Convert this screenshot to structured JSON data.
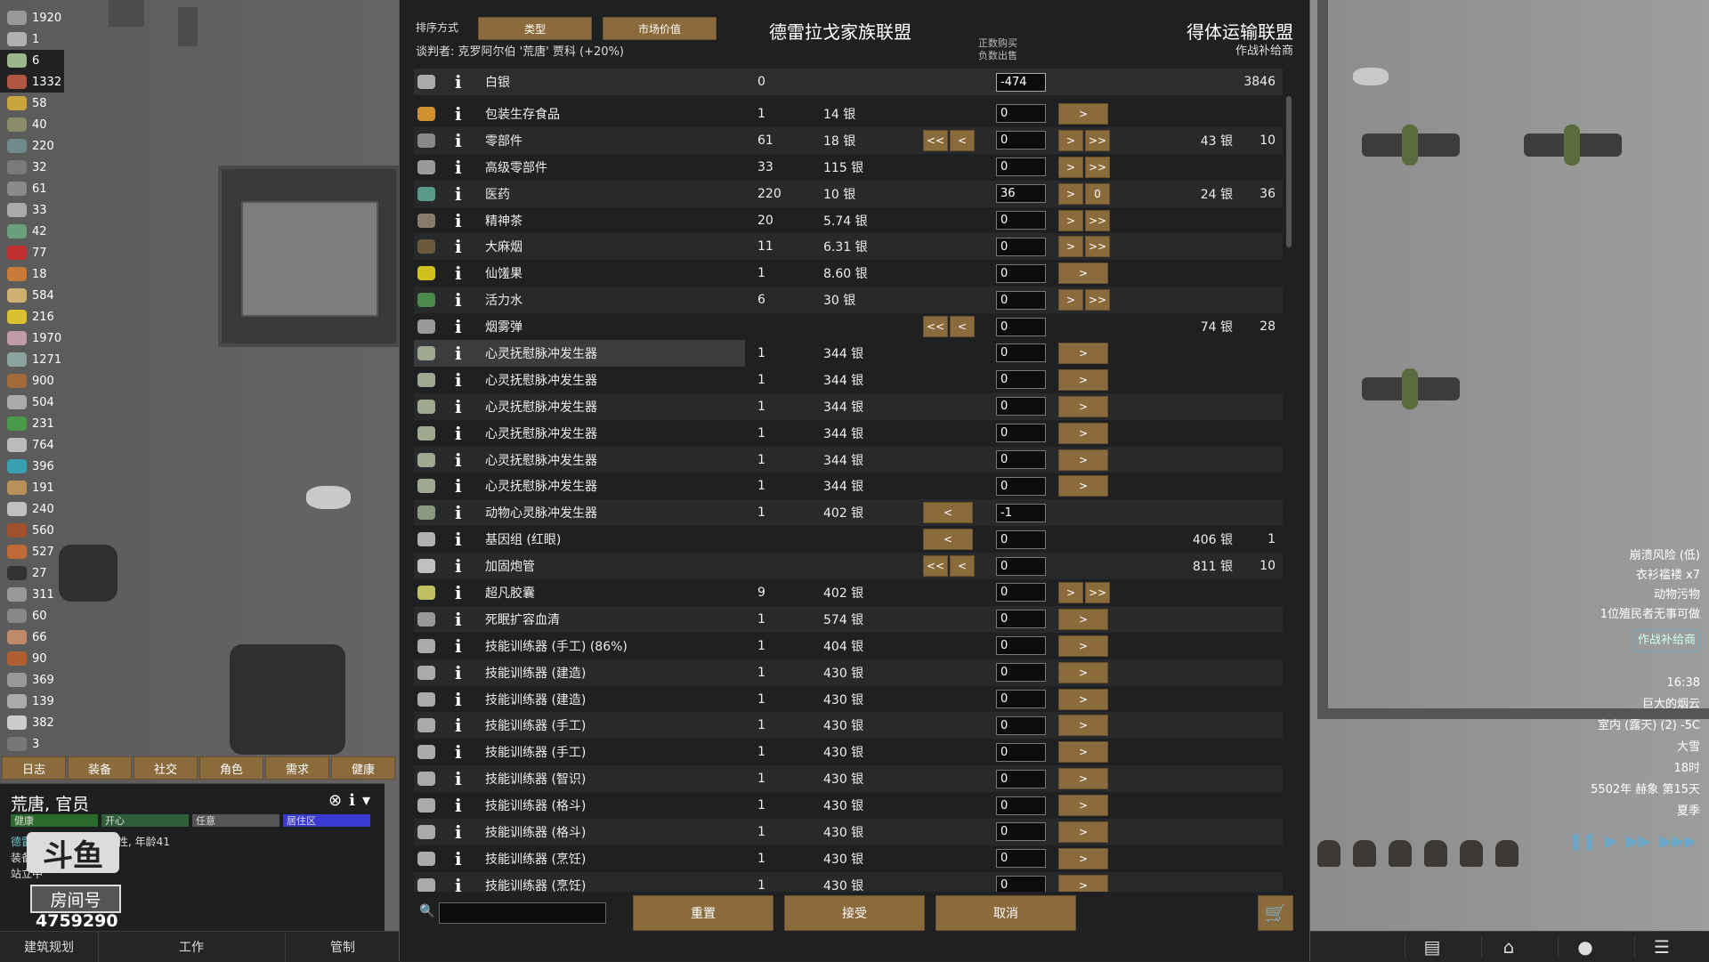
{
  "resources": [
    {
      "value": "1920",
      "color": "#9a9a9a"
    },
    {
      "value": "1",
      "color": "#b0b0b0"
    },
    {
      "value": "6",
      "color": "#9bb68a"
    },
    {
      "value": "1332",
      "color": "#b05540"
    },
    {
      "value": "58",
      "color": "#c9a53c"
    },
    {
      "value": "40",
      "color": "#8c8c6a"
    },
    {
      "value": "220",
      "color": "#6f8a8a"
    },
    {
      "value": "32",
      "color": "#7a7a7a"
    },
    {
      "value": "61",
      "color": "#8a8a8a"
    },
    {
      "value": "33",
      "color": "#aaaaaa"
    },
    {
      "value": "42",
      "color": "#6b9e7a"
    },
    {
      "value": "77",
      "color": "#c03030"
    },
    {
      "value": "18",
      "color": "#c87a3a"
    },
    {
      "value": "584",
      "color": "#d0b070"
    },
    {
      "value": "216",
      "color": "#d8c030"
    },
    {
      "value": "1970",
      "color": "#c09aa8"
    },
    {
      "value": "1271",
      "color": "#8aa2a0"
    },
    {
      "value": "900",
      "color": "#a06a3a"
    },
    {
      "value": "504",
      "color": "#aaaaaa"
    },
    {
      "value": "231",
      "color": "#4a9a4a"
    },
    {
      "value": "764",
      "color": "#bbbbbb"
    },
    {
      "value": "396",
      "color": "#3aa0b0"
    },
    {
      "value": "191",
      "color": "#b8905a"
    },
    {
      "value": "240",
      "color": "#c0c0c0"
    },
    {
      "value": "560",
      "color": "#a0522d"
    },
    {
      "value": "527",
      "color": "#c06a3a"
    },
    {
      "value": "27",
      "color": "#333333"
    },
    {
      "value": "311",
      "color": "#999999"
    },
    {
      "value": "60",
      "color": "#888888"
    },
    {
      "value": "66",
      "color": "#c08a6a"
    },
    {
      "value": "90",
      "color": "#b06030"
    },
    {
      "value": "369",
      "color": "#999999"
    },
    {
      "value": "139",
      "color": "#aaaaaa"
    },
    {
      "value": "382",
      "color": "#cccccc"
    },
    {
      "value": "3",
      "color": "#777777"
    }
  ],
  "pawn_tabs": [
    "日志",
    "装备",
    "社交",
    "角色",
    "需求",
    "健康"
  ],
  "pawn": {
    "name": "荒唐, 官员",
    "bars": [
      {
        "label": "健康",
        "color": "#2a6a2a"
      },
      {
        "label": "开心",
        "color": "#2e5e3a"
      },
      {
        "label": "任意",
        "color": "#555555"
      },
      {
        "label": "居住区",
        "color": "#3a3ad0"
      }
    ],
    "faction_link": "德雷拉戈家族联盟",
    "desc_suffix": "的男性, 年龄41",
    "equipment": "装备: 破晓雨伞",
    "status": "站立中",
    "logo": "斗鱼",
    "room_label": "房间号",
    "room_number": "4759290"
  },
  "bottom_tabs": [
    "建筑规划",
    "工作",
    "管制"
  ],
  "bottom_icons": [
    "book-icon",
    "bank-icon",
    "lightbulb-icon",
    "list-icon"
  ],
  "alerts": {
    "lines": [
      "崩溃风险 (低)",
      "衣衫褴褛 x7",
      "动物污物",
      "1位殖民者无事可做"
    ],
    "boxed": "作战补给商"
  },
  "time_info": [
    "16:38",
    "巨大的烟云",
    "室内 (露天) (2) -5C",
    "大雪",
    "18时",
    "5502年 赫象 第15天",
    "夏季"
  ],
  "trade": {
    "sort_label": "排序方式",
    "sort_buttons": [
      "类型",
      "市场价值"
    ],
    "negotiator": "谈判者: 克罗阿尔伯 '荒唐' 贾科 (+20%)",
    "faction_left": "德雷拉戈家族联盟",
    "pos_note_1": "正数购买",
    "pos_note_2": "负数出售",
    "faction_right": "得体运输联盟",
    "faction_right_sub": "作战补给商",
    "silver": {
      "name": "白银",
      "colony_qty": "0",
      "offer": "-474",
      "trader_qty": "3846",
      "icon_color": "#aaaaaa"
    },
    "rows": [
      {
        "name": "包装生存食品",
        "cq": "1",
        "price": "14 银",
        "l": "",
        "offer": "0",
        "r": ">",
        "tp": "",
        "tq": "",
        "color": "#d09030"
      },
      {
        "name": "零部件",
        "cq": "61",
        "price": "18 银",
        "l": "<< <",
        "offer": "0",
        "r": "> >>",
        "tp": "43 银",
        "tq": "10",
        "color": "#888888"
      },
      {
        "name": "高级零部件",
        "cq": "33",
        "price": "115 银",
        "l": "",
        "offer": "0",
        "r": "> >>",
        "tp": "",
        "tq": "",
        "color": "#999999"
      },
      {
        "name": "医药",
        "cq": "220",
        "price": "10 银",
        "l": "",
        "offer": "36",
        "r": "> 0",
        "tp": "24 银",
        "tq": "36",
        "color": "#5a9a8a"
      },
      {
        "name": "精神茶",
        "cq": "20",
        "price": "5.74 银",
        "l": "",
        "offer": "0",
        "r": "> >>",
        "tp": "",
        "tq": "",
        "color": "#8a7a6a"
      },
      {
        "name": "大麻烟",
        "cq": "11",
        "price": "6.31 银",
        "l": "",
        "offer": "0",
        "r": "> >>",
        "tp": "",
        "tq": "",
        "color": "#6a5a3a"
      },
      {
        "name": "仙馐果",
        "cq": "1",
        "price": "8.60 银",
        "l": "",
        "offer": "0",
        "r": ">",
        "tp": "",
        "tq": "",
        "color": "#d0c020"
      },
      {
        "name": "活力水",
        "cq": "6",
        "price": "30 银",
        "l": "",
        "offer": "0",
        "r": "> >>",
        "tp": "",
        "tq": "",
        "color": "#4a8a4a"
      },
      {
        "name": "烟雾弹",
        "cq": "",
        "price": "",
        "l": "<< <",
        "offer": "0",
        "r": "",
        "tp": "74 银",
        "tq": "28",
        "color": "#9a9a9a"
      },
      {
        "name": "心灵抚慰脉冲发生器",
        "cq": "1",
        "price": "344 银",
        "l": "",
        "offer": "0",
        "r": ">",
        "tp": "",
        "tq": "",
        "color": "#a0a890"
      },
      {
        "name": "心灵抚慰脉冲发生器",
        "cq": "1",
        "price": "344 银",
        "l": "",
        "offer": "0",
        "r": ">",
        "tp": "",
        "tq": "",
        "color": "#a0a890"
      },
      {
        "name": "心灵抚慰脉冲发生器",
        "cq": "1",
        "price": "344 银",
        "l": "",
        "offer": "0",
        "r": ">",
        "tp": "",
        "tq": "",
        "color": "#a0a890"
      },
      {
        "name": "心灵抚慰脉冲发生器",
        "cq": "1",
        "price": "344 银",
        "l": "",
        "offer": "0",
        "r": ">",
        "tp": "",
        "tq": "",
        "color": "#a0a890"
      },
      {
        "name": "心灵抚慰脉冲发生器",
        "cq": "1",
        "price": "344 银",
        "l": "",
        "offer": "0",
        "r": ">",
        "tp": "",
        "tq": "",
        "color": "#a0a890"
      },
      {
        "name": "心灵抚慰脉冲发生器",
        "cq": "1",
        "price": "344 银",
        "l": "",
        "offer": "0",
        "r": ">",
        "tp": "",
        "tq": "",
        "color": "#a0a890"
      },
      {
        "name": "动物心灵脉冲发生器",
        "cq": "1",
        "price": "402 银",
        "l": "<",
        "offer": "-1",
        "r": "",
        "tp": "",
        "tq": "",
        "color": "#8a9a80"
      },
      {
        "name": "基因组 (红眼)",
        "cq": "",
        "price": "",
        "l": "<",
        "offer": "0",
        "r": "",
        "tp": "406 银",
        "tq": "1",
        "color": "#b0b0b0"
      },
      {
        "name": "加固炮管",
        "cq": "",
        "price": "",
        "l": "<< <",
        "offer": "0",
        "r": "",
        "tp": "811 银",
        "tq": "10",
        "color": "#c0c0c0"
      },
      {
        "name": "超凡胶囊",
        "cq": "9",
        "price": "402 银",
        "l": "",
        "offer": "0",
        "r": "> >>",
        "tp": "",
        "tq": "",
        "color": "#c0c060"
      },
      {
        "name": "死眠扩容血清",
        "cq": "1",
        "price": "574 银",
        "l": "",
        "offer": "0",
        "r": ">",
        "tp": "",
        "tq": "",
        "color": "#9a9a9a"
      },
      {
        "name": "技能训练器 (手工) (86%)",
        "cq": "1",
        "price": "404 银",
        "l": "",
        "offer": "0",
        "r": ">",
        "tp": "",
        "tq": "",
        "color": "#aaaaaa"
      },
      {
        "name": "技能训练器 (建造)",
        "cq": "1",
        "price": "430 银",
        "l": "",
        "offer": "0",
        "r": ">",
        "tp": "",
        "tq": "",
        "color": "#aaaaaa"
      },
      {
        "name": "技能训练器 (建造)",
        "cq": "1",
        "price": "430 银",
        "l": "",
        "offer": "0",
        "r": ">",
        "tp": "",
        "tq": "",
        "color": "#aaaaaa"
      },
      {
        "name": "技能训练器 (手工)",
        "cq": "1",
        "price": "430 银",
        "l": "",
        "offer": "0",
        "r": ">",
        "tp": "",
        "tq": "",
        "color": "#aaaaaa"
      },
      {
        "name": "技能训练器 (手工)",
        "cq": "1",
        "price": "430 银",
        "l": "",
        "offer": "0",
        "r": ">",
        "tp": "",
        "tq": "",
        "color": "#aaaaaa"
      },
      {
        "name": "技能训练器 (智识)",
        "cq": "1",
        "price": "430 银",
        "l": "",
        "offer": "0",
        "r": ">",
        "tp": "",
        "tq": "",
        "color": "#aaaaaa"
      },
      {
        "name": "技能训练器 (格斗)",
        "cq": "1",
        "price": "430 银",
        "l": "",
        "offer": "0",
        "r": ">",
        "tp": "",
        "tq": "",
        "color": "#aaaaaa"
      },
      {
        "name": "技能训练器 (格斗)",
        "cq": "1",
        "price": "430 银",
        "l": "",
        "offer": "0",
        "r": ">",
        "tp": "",
        "tq": "",
        "color": "#aaaaaa"
      },
      {
        "name": "技能训练器 (烹饪)",
        "cq": "1",
        "price": "430 银",
        "l": "",
        "offer": "0",
        "r": ">",
        "tp": "",
        "tq": "",
        "color": "#aaaaaa"
      },
      {
        "name": "技能训练器 (烹饪)",
        "cq": "1",
        "price": "430 银",
        "l": "",
        "offer": "0",
        "r": ">",
        "tp": "",
        "tq": "",
        "color": "#aaaaaa"
      }
    ],
    "info_glyph": "i",
    "buttons": {
      "reset": "重置",
      "accept": "接受",
      "cancel": "取消"
    }
  }
}
